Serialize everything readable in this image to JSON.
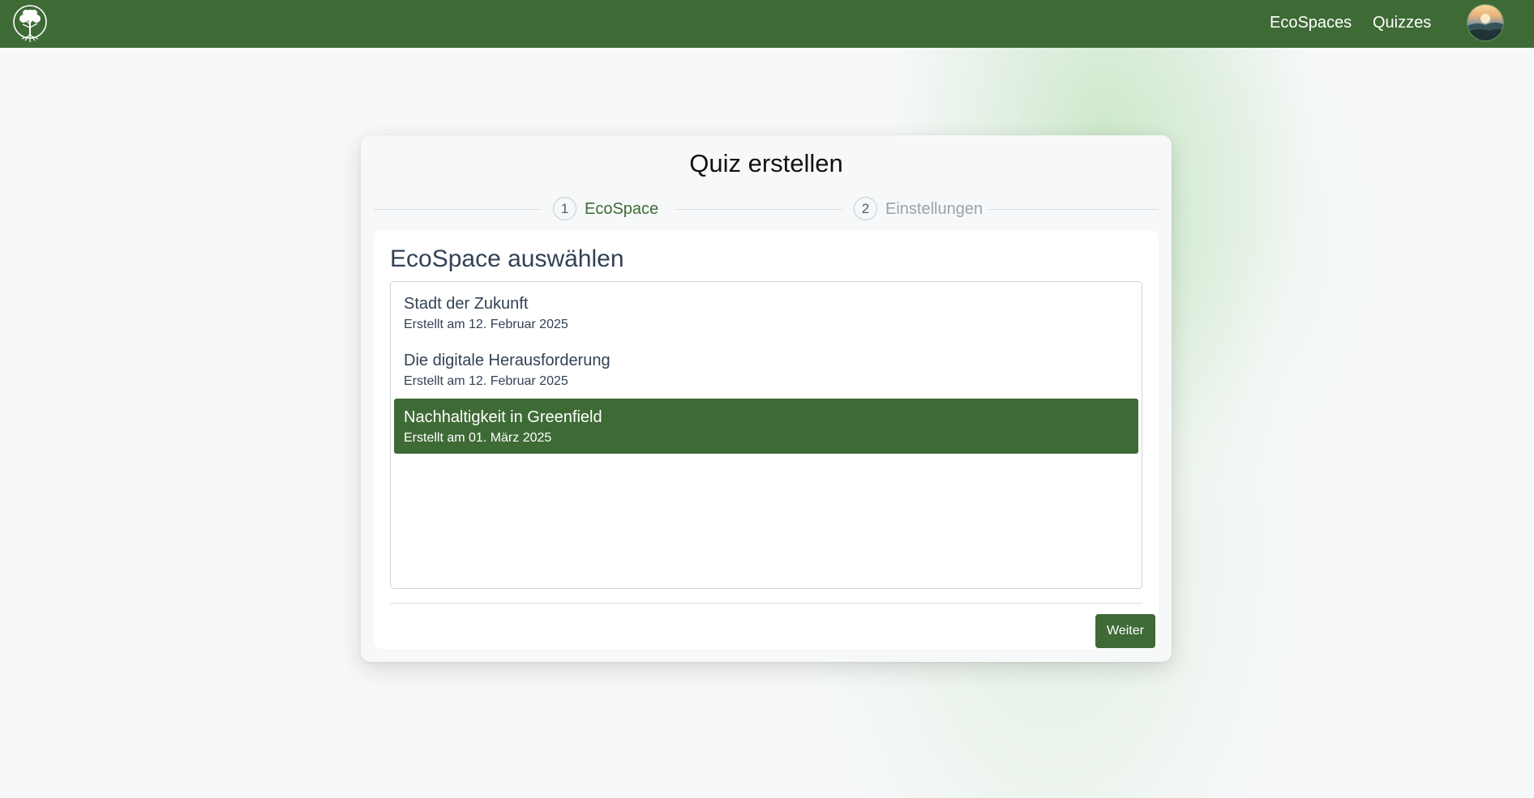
{
  "navbar": {
    "logo_icon": "tree-logo-icon",
    "links": [
      "EcoSpaces",
      "Quizzes"
    ],
    "avatar_icon": "user-avatar"
  },
  "card": {
    "title": "Quiz erstellen",
    "steps": [
      {
        "number": "1",
        "label": "EcoSpace",
        "state": "active"
      },
      {
        "number": "2",
        "label": "Einstellungen",
        "state": "inactive"
      }
    ],
    "section_title": "EcoSpace auswählen",
    "ecospaces": [
      {
        "name": "Stadt der Zukunft",
        "created": "Erstellt am 12. Februar 2025",
        "selected": false
      },
      {
        "name": "Die digitale Herausforderung",
        "created": "Erstellt am 12. Februar 2025",
        "selected": false
      },
      {
        "name": "Nachhaltigkeit in Greenfield",
        "created": "Erstellt am 01. März 2025",
        "selected": true
      }
    ],
    "next_button": "Weiter"
  },
  "colors": {
    "primary": "#3e6a36",
    "background": "#f6f8f9",
    "text": "#334155"
  }
}
